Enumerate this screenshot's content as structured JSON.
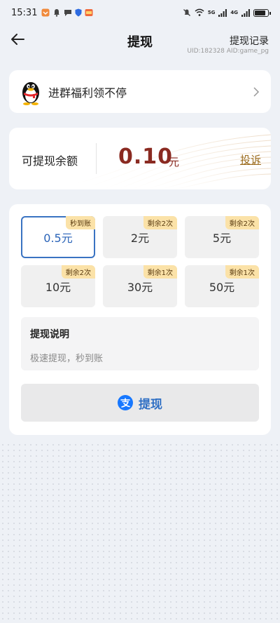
{
  "status": {
    "time": "15:31",
    "net1": "5G",
    "net2": "4G"
  },
  "header": {
    "title": "提现",
    "record": "提现记录",
    "uid": "UID:182328 AID:game_pg"
  },
  "group": {
    "text": "进群福利领不停"
  },
  "balance": {
    "label": "可提现余额",
    "amount": "0.10",
    "unit": "元",
    "complain": "投诉"
  },
  "options": [
    {
      "amount": "0.5元",
      "tag": "秒到账"
    },
    {
      "amount": "2元",
      "tag": "剩余2次"
    },
    {
      "amount": "5元",
      "tag": "剩余2次"
    },
    {
      "amount": "10元",
      "tag": "剩余2次"
    },
    {
      "amount": "30元",
      "tag": "剩余1次"
    },
    {
      "amount": "50元",
      "tag": "剩余1次"
    }
  ],
  "description": {
    "title": "提现说明",
    "body": "极速提现，秒到账"
  },
  "withdraw_button": {
    "label": "提现"
  },
  "colors": {
    "accent": "#3a73c2",
    "amount": "#8a2a21",
    "tag_bg": "#fbe2a8"
  }
}
